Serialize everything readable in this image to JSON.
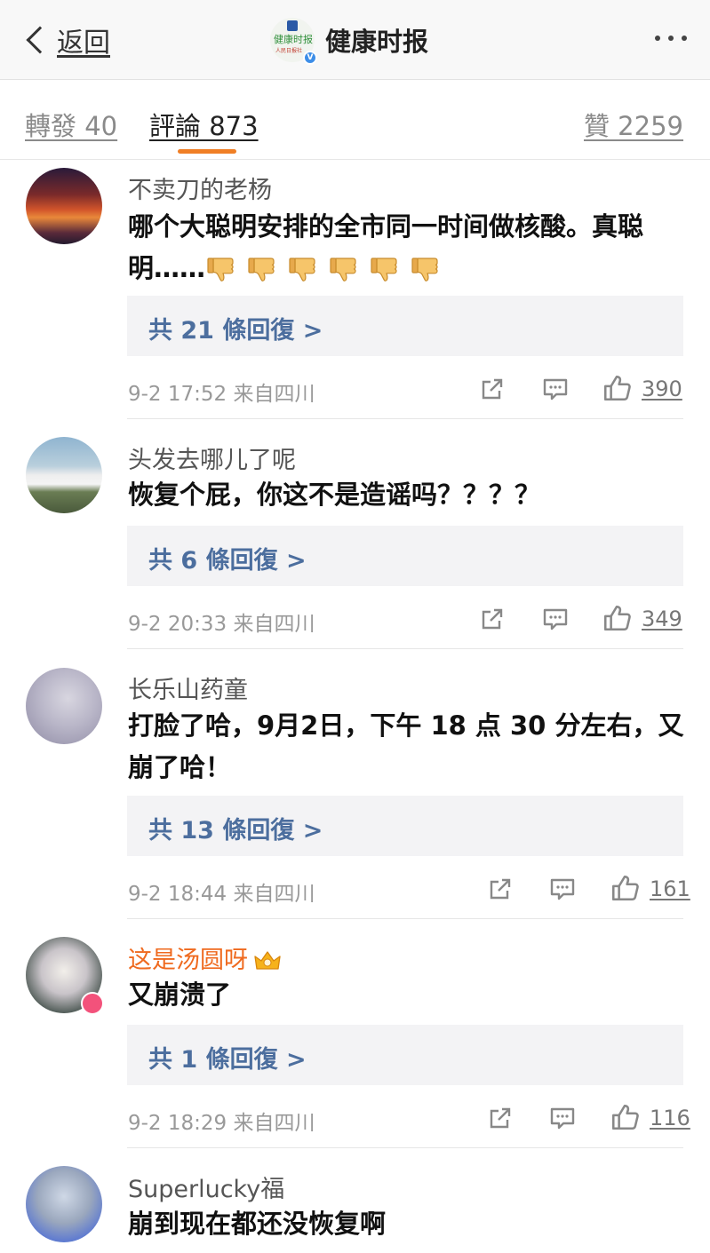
{
  "header": {
    "back_label": "返回",
    "title": "健康时报",
    "logo_text": "健康时报",
    "logo_sub": "人民日报社"
  },
  "tabs": {
    "forward": "轉發 40",
    "comments": "評論 873",
    "likes": "贊 2259"
  },
  "comments": [
    {
      "user": "不卖刀的老杨",
      "text": "哪个大聪明安排的全市同一时间做核酸。真聪明……",
      "emoji": "thumbs-down-emoji",
      "emoji_count": 6,
      "replies": "共 21 條回復 >",
      "time": "9-2 17:52",
      "location": "来自四川",
      "likes": "390"
    },
    {
      "user": "头发去哪儿了呢",
      "text": "恢复个屁，你这不是造谣吗？？？？",
      "replies": "共 6 條回復 >",
      "time": "9-2 20:33",
      "location": "来自四川",
      "likes": "349"
    },
    {
      "user": "长乐山药童",
      "text": "打脸了哈，9月2日，下午 18 点 30 分左右，又崩了哈！",
      "replies": "共 13 條回復 >",
      "time": "9-2 18:44",
      "location": "来自四川",
      "likes": "161"
    },
    {
      "user": "这是汤圆呀",
      "user_badge": "crown-icon",
      "text": "又崩溃了",
      "replies": "共 1 條回復 >",
      "time": "9-2 18:29",
      "location": "来自四川",
      "likes": "116"
    },
    {
      "user": "Superlucky福",
      "text": "崩到现在都还没恢复啊"
    }
  ],
  "colors": {
    "accent": "#f07f25",
    "reply_link": "#4c6e9e",
    "vip_name": "#ef6a1f"
  }
}
